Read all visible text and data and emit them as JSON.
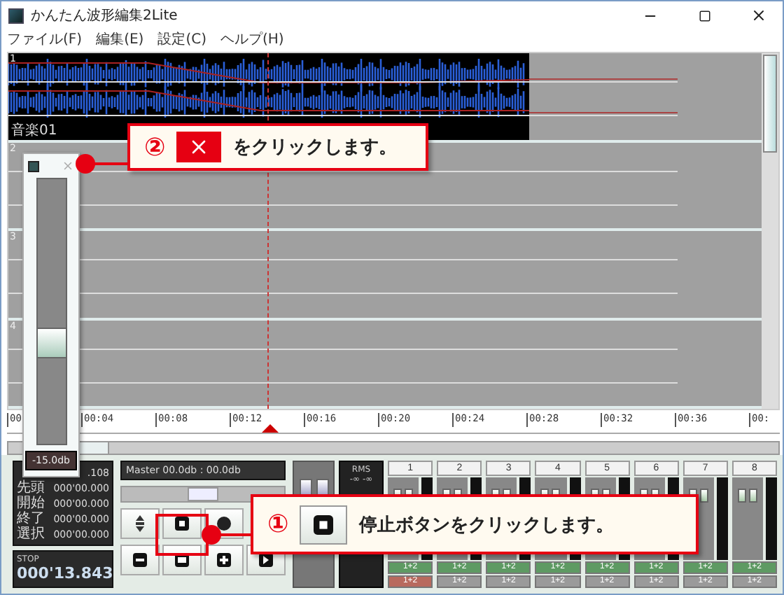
{
  "window": {
    "title": "かんたん波形編集2Lite"
  },
  "menu": [
    {
      "label": "ファイル(F)"
    },
    {
      "label": "編集(E)"
    },
    {
      "label": "設定(C)"
    },
    {
      "label": "ヘルプ(H)"
    }
  ],
  "tracks": [
    {
      "number": "1",
      "clip_label": "音楽01"
    },
    {
      "number": "2"
    },
    {
      "number": "3"
    },
    {
      "number": "4"
    }
  ],
  "ruler": [
    "00",
    "00:04",
    "00:08",
    "00:12",
    "00:16",
    "00:20",
    "00:24",
    "00:28",
    "00:32",
    "00:36",
    "00:"
  ],
  "volume_popup": {
    "level": 0.38,
    "reading": "-15.0db"
  },
  "time_display": {
    "rows": [
      {
        "value": ".108"
      },
      {
        "label": "先頭",
        "value": "000'00.000"
      },
      {
        "label": "開始",
        "value": "000'00.000"
      },
      {
        "label": "終了",
        "value": "000'00.000"
      },
      {
        "label": "選択",
        "value": "000'00.000"
      }
    ],
    "status": "STOP",
    "counter": "000'13.843"
  },
  "master": {
    "text": "Master 00.0db : 00.0db",
    "level": 0.5
  },
  "rms": {
    "title": "RMS",
    "reading": "-∞ -∞"
  },
  "channels": [
    {
      "number": "1",
      "sends": [
        {
          "text": "1+2",
          "color": "#5e9a63"
        },
        {
          "text": "1+2",
          "color": "#b86a5e"
        }
      ]
    },
    {
      "number": "2",
      "sends": [
        {
          "text": "1+2",
          "color": "#5e9a63"
        },
        {
          "text": "1+2",
          "color": "#9a9a9a"
        }
      ]
    },
    {
      "number": "3",
      "sends": [
        {
          "text": "1+2",
          "color": "#5e9a63"
        },
        {
          "text": "1+2",
          "color": "#9a9a9a"
        }
      ]
    },
    {
      "number": "4",
      "sends": [
        {
          "text": "1+2",
          "color": "#5e9a63"
        },
        {
          "text": "1+2",
          "color": "#9a9a9a"
        }
      ]
    },
    {
      "number": "5",
      "sends": [
        {
          "text": "1+2",
          "color": "#5e9a63"
        },
        {
          "text": "1+2",
          "color": "#9a9a9a"
        }
      ]
    },
    {
      "number": "6",
      "sends": [
        {
          "text": "1+2",
          "color": "#5e9a63"
        },
        {
          "text": "1+2",
          "color": "#9a9a9a"
        }
      ]
    },
    {
      "number": "7",
      "sends": [
        {
          "text": "1+2",
          "color": "#5e9a63"
        },
        {
          "text": "1+2",
          "color": "#9a9a9a"
        }
      ]
    },
    {
      "number": "8",
      "sends": [
        {
          "text": "1+2",
          "color": "#5e9a63"
        },
        {
          "text": "1+2",
          "color": "#9a9a9a"
        }
      ]
    }
  ],
  "callouts": [
    {
      "number": "②",
      "kind": "close",
      "text": "をクリックします。"
    },
    {
      "number": "①",
      "kind": "stop",
      "text": "停止ボタンをクリックします。"
    }
  ]
}
